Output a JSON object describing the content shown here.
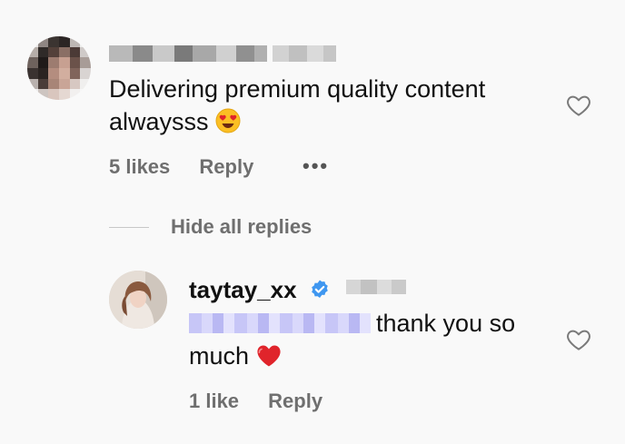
{
  "comment": {
    "text": "Delivering premium quality content alwaysss",
    "emoji": "heart-eyes-emoji",
    "likes": "5 likes",
    "reply_label": "Reply",
    "more_label": "•••"
  },
  "thread": {
    "toggle_label": "Hide all replies"
  },
  "reply": {
    "username": "taytay_xx",
    "text": "thank you so much",
    "emoji": "red-heart-emoji",
    "likes": "1 like",
    "reply_label": "Reply"
  },
  "colors": {
    "background": "#f9f9f9",
    "muted_text": "#6f6f6f",
    "verified_badge": "#3f97f0",
    "heart_red": "#e0242b"
  }
}
